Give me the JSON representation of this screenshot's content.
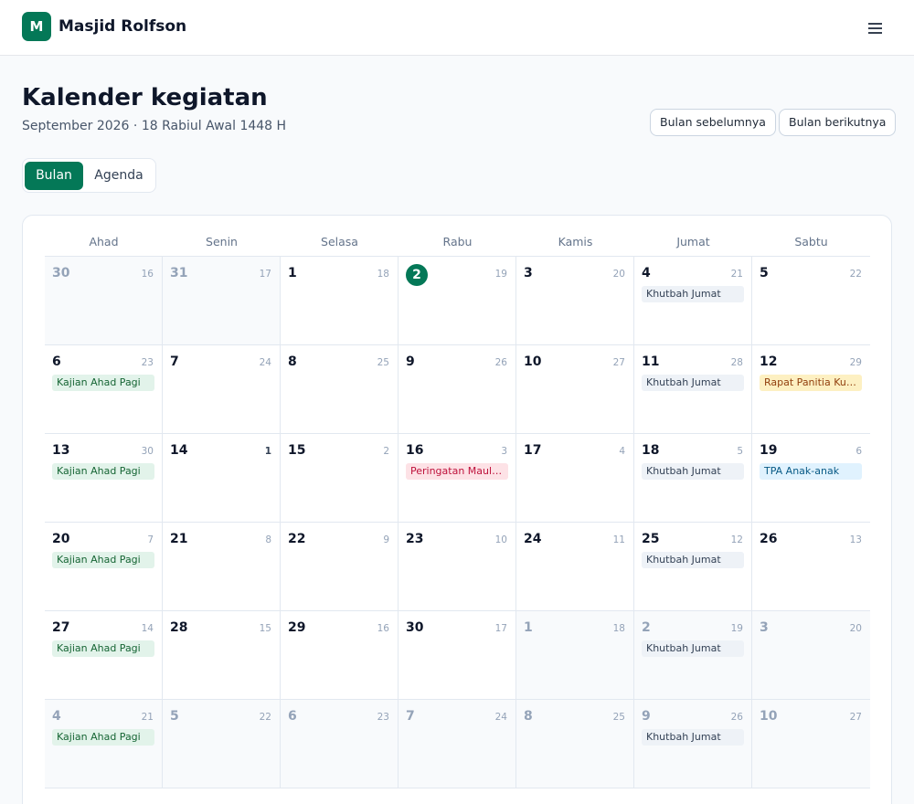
{
  "app": {
    "logo_letter": "M",
    "name": "Masjid Rolfson",
    "menu_icon": "hamburger-menu-icon"
  },
  "page": {
    "title": "Kalender kegiatan",
    "subtitle": "September 2026 · 18 Rabiul Awal 1448 H",
    "prev_button": "Bulan sebelumnya",
    "next_button": "Bulan berikutnya"
  },
  "view_toggle": {
    "month": "Bulan",
    "agenda": "Agenda",
    "active": "month"
  },
  "colors": {
    "accent": "#047857",
    "khutbah": "#eef2f7",
    "kajian": "#e2f3ea",
    "rapat": "#fdf0c2",
    "maulid": "#fde2e6",
    "tpa": "#e0f2fe"
  },
  "calendar": {
    "weekdays": [
      "Ahad",
      "Senin",
      "Selasa",
      "Rabu",
      "Kamis",
      "Jumat",
      "Sabtu"
    ],
    "weeks": [
      [
        {
          "day": "30",
          "hijri": "16",
          "outside": true
        },
        {
          "day": "31",
          "hijri": "17",
          "outside": true
        },
        {
          "day": "1",
          "hijri": "18"
        },
        {
          "day": "2",
          "hijri": "19",
          "today": true
        },
        {
          "day": "3",
          "hijri": "20"
        },
        {
          "day": "4",
          "hijri": "21",
          "event": {
            "label": "Khutbah Jumat",
            "kind": "khutbah"
          }
        },
        {
          "day": "5",
          "hijri": "22"
        }
      ],
      [
        {
          "day": "6",
          "hijri": "23",
          "event": {
            "label": "Kajian Ahad Pagi",
            "kind": "kajian"
          }
        },
        {
          "day": "7",
          "hijri": "24"
        },
        {
          "day": "8",
          "hijri": "25"
        },
        {
          "day": "9",
          "hijri": "26"
        },
        {
          "day": "10",
          "hijri": "27"
        },
        {
          "day": "11",
          "hijri": "28",
          "event": {
            "label": "Khutbah Jumat",
            "kind": "khutbah"
          }
        },
        {
          "day": "12",
          "hijri": "29",
          "event": {
            "label": "Rapat Panitia Ku…",
            "kind": "rapat"
          }
        }
      ],
      [
        {
          "day": "13",
          "hijri": "30",
          "event": {
            "label": "Kajian Ahad Pagi",
            "kind": "kajian"
          }
        },
        {
          "day": "14",
          "hijri": "1",
          "hijri_strong": true
        },
        {
          "day": "15",
          "hijri": "2"
        },
        {
          "day": "16",
          "hijri": "3",
          "event": {
            "label": "Peringatan Mauli…",
            "kind": "maulid"
          }
        },
        {
          "day": "17",
          "hijri": "4"
        },
        {
          "day": "18",
          "hijri": "5",
          "event": {
            "label": "Khutbah Jumat",
            "kind": "khutbah"
          }
        },
        {
          "day": "19",
          "hijri": "6",
          "event": {
            "label": "TPA Anak-anak",
            "kind": "tpa"
          }
        }
      ],
      [
        {
          "day": "20",
          "hijri": "7",
          "event": {
            "label": "Kajian Ahad Pagi",
            "kind": "kajian"
          }
        },
        {
          "day": "21",
          "hijri": "8"
        },
        {
          "day": "22",
          "hijri": "9"
        },
        {
          "day": "23",
          "hijri": "10"
        },
        {
          "day": "24",
          "hijri": "11"
        },
        {
          "day": "25",
          "hijri": "12",
          "event": {
            "label": "Khutbah Jumat",
            "kind": "khutbah"
          }
        },
        {
          "day": "26",
          "hijri": "13"
        }
      ],
      [
        {
          "day": "27",
          "hijri": "14",
          "event": {
            "label": "Kajian Ahad Pagi",
            "kind": "kajian"
          }
        },
        {
          "day": "28",
          "hijri": "15"
        },
        {
          "day": "29",
          "hijri": "16"
        },
        {
          "day": "30",
          "hijri": "17"
        },
        {
          "day": "1",
          "hijri": "18",
          "outside": true
        },
        {
          "day": "2",
          "hijri": "19",
          "outside": true,
          "event": {
            "label": "Khutbah Jumat",
            "kind": "khutbah"
          }
        },
        {
          "day": "3",
          "hijri": "20",
          "outside": true
        }
      ],
      [
        {
          "day": "4",
          "hijri": "21",
          "outside": true,
          "event": {
            "label": "Kajian Ahad Pagi",
            "kind": "kajian"
          }
        },
        {
          "day": "5",
          "hijri": "22",
          "outside": true
        },
        {
          "day": "6",
          "hijri": "23",
          "outside": true
        },
        {
          "day": "7",
          "hijri": "24",
          "outside": true
        },
        {
          "day": "8",
          "hijri": "25",
          "outside": true
        },
        {
          "day": "9",
          "hijri": "26",
          "outside": true,
          "event": {
            "label": "Khutbah Jumat",
            "kind": "khutbah"
          }
        },
        {
          "day": "10",
          "hijri": "27",
          "outside": true
        }
      ]
    ]
  }
}
